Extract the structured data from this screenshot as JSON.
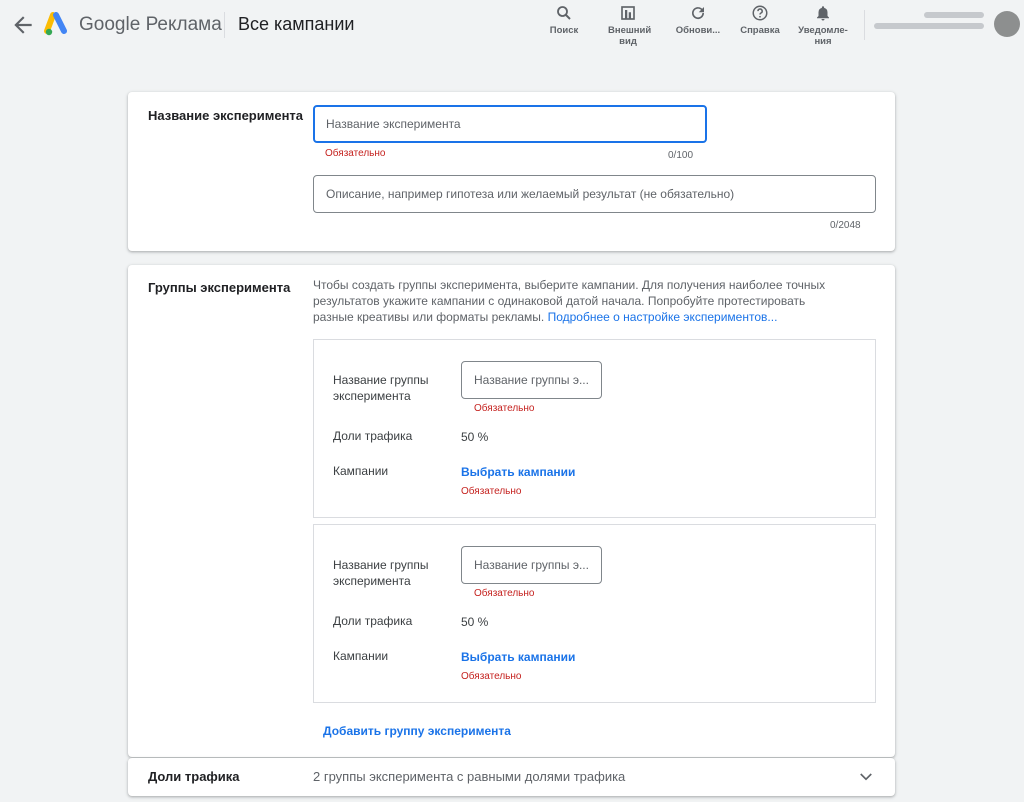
{
  "header": {
    "brand_google": "Google",
    "brand_product": "Реклама",
    "title": "Все кампании",
    "tools": [
      {
        "label": "Поиск",
        "icon": "search-icon"
      },
      {
        "label": "Внешний вид",
        "icon": "appearance-icon"
      },
      {
        "label": "Обнови...",
        "icon": "refresh-icon"
      },
      {
        "label": "Справка",
        "icon": "help-icon"
      },
      {
        "label": "Уведомле-ния",
        "icon": "bell-icon"
      }
    ]
  },
  "experiment_name": {
    "section_label": "Название эксперимента",
    "name_placeholder": "Название эксперимента",
    "name_required": "Обязательно",
    "name_counter": "0/100",
    "description_placeholder": "Описание, например гипотеза или желаемый результат (не обязательно)",
    "description_counter": "0/2048"
  },
  "experiment_groups": {
    "section_label": "Группы эксперимента",
    "description": "Чтобы создать группы эксперимента, выберите кампании. Для получения наиболее точных результатов укажите кампании с одинаковой датой начала. Попробуйте протестировать разные креативы или форматы рекламы.",
    "learn_more": "Подробнее о настройке экспериментов...",
    "groups": [
      {
        "name_label": "Название группы эксперимента",
        "name_placeholder": "Название группы э...",
        "name_required": "Обязательно",
        "traffic_label": "Доли трафика",
        "traffic_value": "50 %",
        "campaigns_label": "Кампании",
        "campaigns_link": "Выбрать кампании",
        "campaigns_required": "Обязательно"
      },
      {
        "name_label": "Название группы эксперимента",
        "name_placeholder": "Название группы э...",
        "name_required": "Обязательно",
        "traffic_label": "Доли трафика",
        "traffic_value": "50 %",
        "campaigns_label": "Кампании",
        "campaigns_link": "Выбрать кампании",
        "campaigns_required": "Обязательно"
      }
    ],
    "add_group": "Добавить группу эксперимента"
  },
  "traffic_split": {
    "section_label": "Доли трафика",
    "summary": "2 группы эксперимента с равными долями трафика"
  },
  "colors": {
    "accent": "#1a73e8",
    "error": "#c5221f",
    "background": "#f1f3f4"
  }
}
